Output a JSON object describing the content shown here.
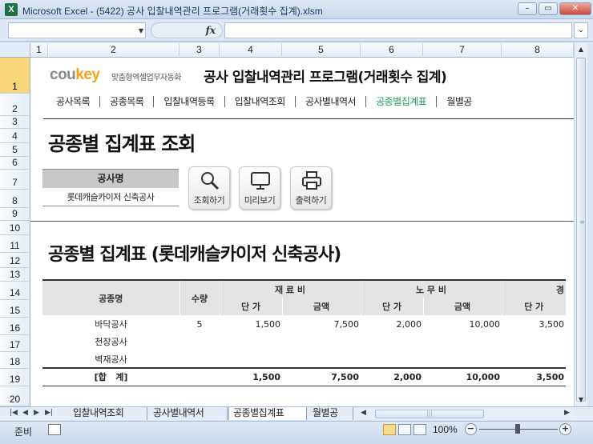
{
  "window": {
    "title": "Microsoft Excel - (5422) 공사 입찰내역관리 프로그램(거래횟수 집계).xlsm",
    "app_icon": "X"
  },
  "formula": {
    "fx": "fx"
  },
  "columns": [
    "1",
    "2",
    "3",
    "4",
    "5",
    "6",
    "7",
    "8"
  ],
  "rows": [
    "1",
    "2",
    "3",
    "4",
    "5",
    "6",
    "7",
    "8",
    "9",
    "10",
    "11",
    "12",
    "13",
    "14",
    "15",
    "16",
    "17",
    "18",
    "19",
    "20"
  ],
  "header": {
    "logo_a": "cou",
    "logo_b": "key",
    "logo_sub": "맞춤형엑셀업무자동화",
    "title": "공사 입찰내역관리 프로그램(거래횟수 집계)"
  },
  "nav": [
    "공사목록",
    "공종목록",
    "입찰내역등록",
    "입찰내역조회",
    "공사별내역서",
    "공종별집계표",
    "월별공"
  ],
  "page": {
    "heading": "공종별 집계표 조회",
    "project_label": "공사명",
    "project_value": "롯데캐슬카이저 신축공사"
  },
  "buttons": {
    "search": "조회하기",
    "preview": "미리보기",
    "print": "출력하기"
  },
  "report": {
    "title": "공종별 집계표 (롯데캐슬카이저 신축공사)",
    "headers": {
      "trade": "공종명",
      "qty": "수량",
      "material": "재 료 비",
      "labor": "노 무 비",
      "expense": "경",
      "unit_price": "단 가",
      "amount": "금액"
    },
    "rows": [
      {
        "name": "바닥공사",
        "qty": "5",
        "mat_unit": "1,500",
        "mat_amount": "7,500",
        "lab_unit": "2,000",
        "lab_amount": "10,000",
        "exp_unit": "3,500"
      },
      {
        "name": "천장공사",
        "qty": "",
        "mat_unit": "",
        "mat_amount": "",
        "lab_unit": "",
        "lab_amount": "",
        "exp_unit": ""
      },
      {
        "name": "벽재공사",
        "qty": "",
        "mat_unit": "",
        "mat_amount": "",
        "lab_unit": "",
        "lab_amount": "",
        "exp_unit": ""
      }
    ],
    "total": {
      "label": "[합   계]",
      "mat_unit": "1,500",
      "mat_amount": "7,500",
      "lab_unit": "2,000",
      "lab_amount": "10,000",
      "exp_unit": "3,500"
    }
  },
  "sheet_tabs": [
    "입찰내역조회",
    "공사별내역서",
    "공종별집계표",
    "월별공"
  ],
  "status": {
    "ready": "준비",
    "zoom": "100%"
  }
}
